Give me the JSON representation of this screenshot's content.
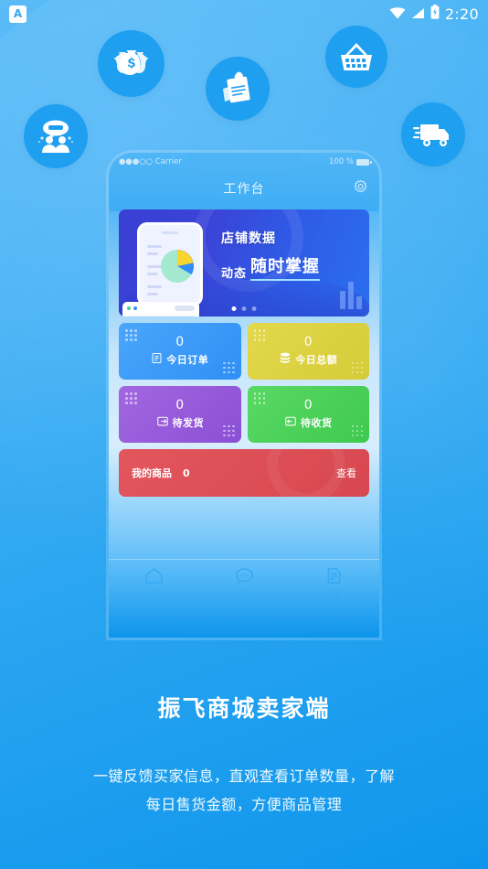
{
  "statusbar": {
    "app_badge_letter": "A",
    "time": "2:20",
    "icons": [
      "wifi-icon",
      "signal-icon",
      "battery-charging-icon"
    ]
  },
  "decorations": [
    {
      "name": "money-bags-icon"
    },
    {
      "name": "clipboard-icon"
    },
    {
      "name": "shopping-basket-icon"
    },
    {
      "name": "customer-chat-icon"
    },
    {
      "name": "delivery-truck-icon"
    }
  ],
  "phone": {
    "status": {
      "carrier": "●●●○○ Carrier",
      "battery": "100 %"
    },
    "header": {
      "title": "工作台",
      "settings_icon": "gear-icon"
    },
    "banner": {
      "line1": "店铺数据",
      "line2_small": "动态",
      "line2_big": "随时掌握",
      "carousel_dots": 3,
      "active_dot": 0,
      "chart": {
        "type": "pie",
        "slices": [
          {
            "label": "",
            "value": 58,
            "color": "#a5e8d0"
          },
          {
            "label": "",
            "value": 17,
            "color": "#f7d52e"
          },
          {
            "label": "",
            "value": 25,
            "color": "#2f8df5"
          }
        ]
      }
    },
    "stats": [
      {
        "value": "0",
        "label": "今日订单",
        "icon": "order-list-icon",
        "color": "#3f9df8"
      },
      {
        "value": "0",
        "label": "今日总额",
        "icon": "coins-stack-icon",
        "color": "#ddd344"
      },
      {
        "value": "0",
        "label": "待发货",
        "icon": "package-out-icon",
        "color": "#9a5ddb"
      },
      {
        "value": "0",
        "label": "待收货",
        "icon": "package-in-icon",
        "color": "#4cd157"
      }
    ],
    "product_card": {
      "label": "我的商品",
      "value": "0",
      "action": "查看",
      "color": "#dd4f57"
    },
    "tabbar": [
      {
        "label": "工作站",
        "icon": "home-icon",
        "active": true
      },
      {
        "label": "消息",
        "icon": "message-icon",
        "active": false
      },
      {
        "label": "订单",
        "icon": "order-doc-icon",
        "active": false
      }
    ]
  },
  "footer": {
    "title": "振飞商城卖家端",
    "description": "一键反馈买家信息，直观查看订单数量，了解\n每日售货金额，方便商品管理",
    "description_line1": "一键反馈买家信息，直观查看订单数量，了解",
    "description_line2": "每日售货金额，方便商品管理"
  },
  "colors": {
    "background_top": "#54b9f7",
    "background_bottom": "#0e96ec",
    "deco_circle": "#1f9ff0",
    "banner_blue": "#3b3fd4"
  }
}
